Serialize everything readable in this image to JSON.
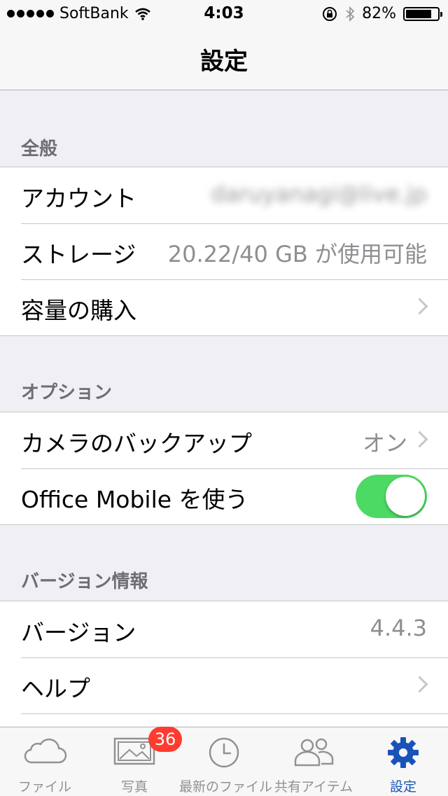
{
  "status_bar": {
    "carrier": "SoftBank",
    "time": "4:03",
    "battery_percent": "82%",
    "battery_level": 0.82
  },
  "nav": {
    "title": "設定"
  },
  "sections": {
    "general": {
      "header": "全般",
      "account_label": "アカウント",
      "account_value": "daruyanagi@live.jp",
      "storage_label": "ストレージ",
      "storage_value": "20.22/40 GB が使用可能",
      "purchase_label": "容量の購入"
    },
    "options": {
      "header": "オプション",
      "camera_backup_label": "カメラのバックアップ",
      "camera_backup_value": "オン",
      "office_mobile_label": "Office Mobile を使う",
      "office_mobile_enabled": true
    },
    "version_info": {
      "header": "バージョン情報",
      "version_label": "バージョン",
      "version_value": "4.4.3",
      "help_label": "ヘルプ"
    }
  },
  "tabbar": {
    "tabs": [
      {
        "label": "ファイル",
        "icon": "cloud-icon"
      },
      {
        "label": "写真",
        "icon": "photos-icon",
        "badge": "36"
      },
      {
        "label": "最新のファイル",
        "icon": "clock-icon"
      },
      {
        "label": "共有アイテム",
        "icon": "people-icon"
      },
      {
        "label": "設定",
        "icon": "gear-icon",
        "active": true
      }
    ]
  },
  "colors": {
    "accent": "#1a53b8",
    "toggle_on": "#4cd964",
    "badge": "#ff3b30"
  }
}
